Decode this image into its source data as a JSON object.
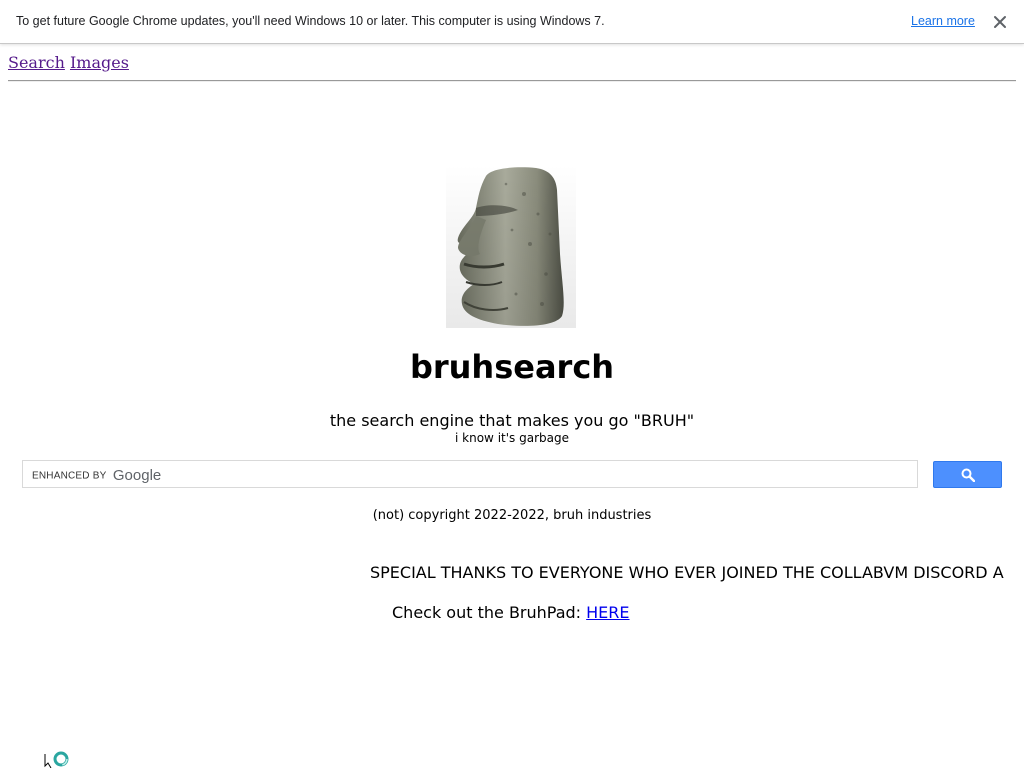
{
  "infobar": {
    "message": "To get future Google Chrome updates, you'll need Windows 10 or later. This computer is using Windows 7.",
    "learn_more": "Learn more"
  },
  "nav": {
    "links": [
      "Search",
      "Images"
    ]
  },
  "hero": {
    "title": "bruhsearch",
    "tagline": "the search engine that makes you go \"BRUH\"",
    "subtagline": "i know it's garbage"
  },
  "search": {
    "enhanced_by": "ENHANCED BY",
    "provider": "Google",
    "value": ""
  },
  "footer": {
    "copyright": "(not) copyright 2022-2022, bruh industries",
    "marquee": "SPECIAL THANKS TO EVERYONE WHO EVER JOINED THE COLLABVM DISCORD A",
    "bruhpad_prefix": "Check out the BruhPad: ",
    "bruhpad_link": "HERE"
  },
  "colors": {
    "link_visited": "#551a8b",
    "link": "#0000ee",
    "search_button": "#4d90fe",
    "infobar_link": "#1a73e8"
  },
  "icons": [
    "close-icon",
    "search-icon",
    "moai-image",
    "busy-cursor-icon"
  ]
}
